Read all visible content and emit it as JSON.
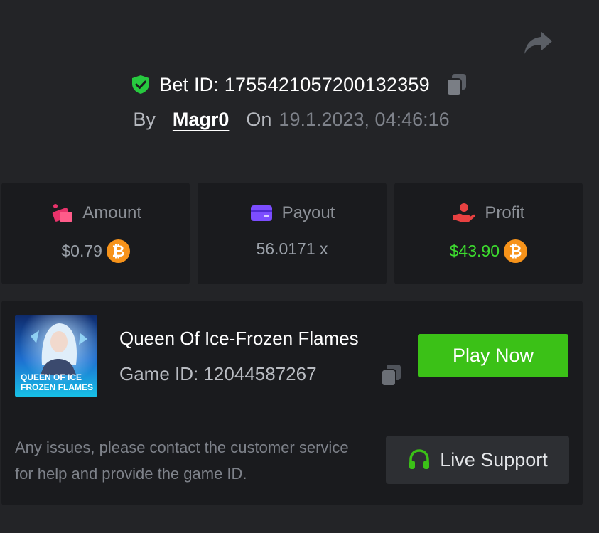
{
  "header": {
    "bet_title": "Bet ID: 1755421057200132359",
    "by_label": "By",
    "username": "Magr0",
    "on_label": "On",
    "datetime": "19.1.2023, 04:46:16"
  },
  "stats": [
    {
      "label": "Amount",
      "value": "$0.79",
      "icon": "amount-icon",
      "currency_icon": "bitcoin-icon",
      "color": "#9aa0a8"
    },
    {
      "label": "Payout",
      "value": "56.0171 x",
      "icon": "wallet-card-icon",
      "color": "#9aa0a8"
    },
    {
      "label": "Profit",
      "value": "$43.90",
      "icon": "profit-hand-icon",
      "currency_icon": "bitcoin-icon",
      "color": "#3ddc2f"
    }
  ],
  "game": {
    "thumbnail_text_line1": "QUEEN OF ICE",
    "thumbnail_text_line2": "FROZEN FLAMES",
    "title": "Queen Of Ice-Frozen Flames",
    "game_id": "Game ID: 12044587267",
    "play_label": "Play Now"
  },
  "support": {
    "message": "Any issues, please contact the customer service for help and provide the game ID.",
    "button_label": "Live Support"
  },
  "colors": {
    "background": "#232427",
    "card": "#1a1b1e",
    "accent_green": "#3bc117",
    "profit_green": "#3ddc2f",
    "bitcoin_orange": "#f7931a",
    "shield_green": "#27c93f",
    "payout_purple": "#7c4dff",
    "amount_pink": "#e8336b",
    "profit_red": "#e84141"
  }
}
